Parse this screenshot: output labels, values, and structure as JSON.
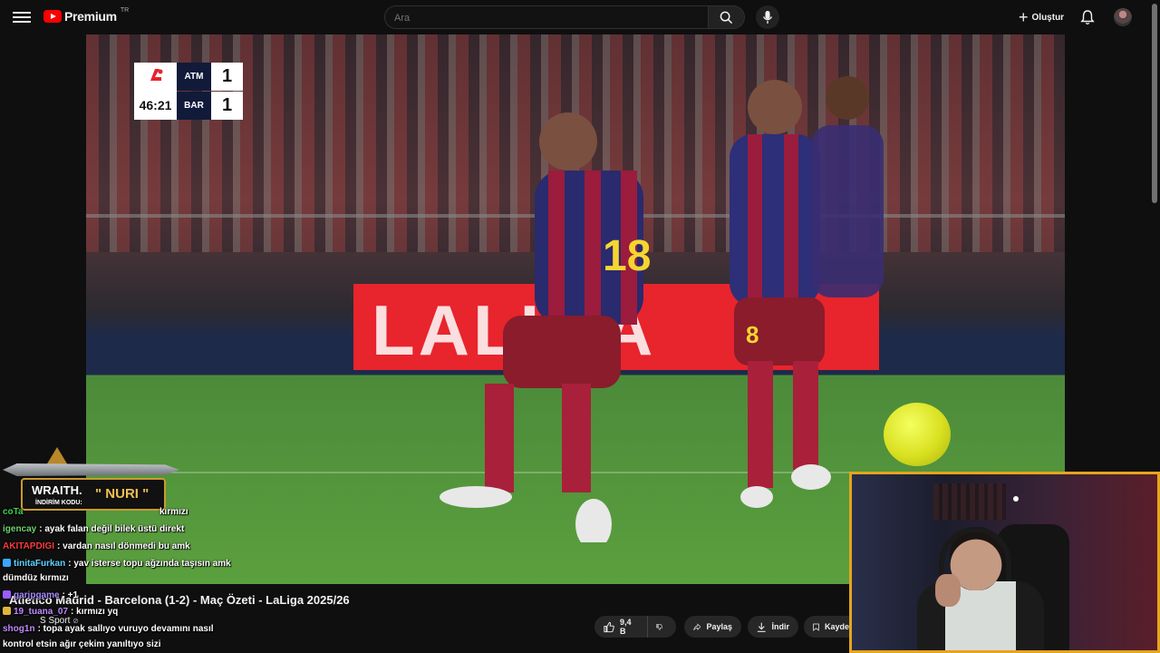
{
  "header": {
    "logo_text": "Premium",
    "logo_region": "TR",
    "search_placeholder": "Ara",
    "create_label": "Oluştur"
  },
  "scoreboard": {
    "clock": "46:21",
    "home_team": "ATM",
    "home_score": "1",
    "away_team": "BAR",
    "away_score": "1"
  },
  "video": {
    "board_text": "LALIGA",
    "title": "Atletico Madrid - Barcelona (1-2) - Maç Özeti - LaLiga 2025/26",
    "channel": "S Sport",
    "verified_mark": "⊘"
  },
  "actions": {
    "like_count": "9,4 B",
    "share_label": "Paylaş",
    "download_label": "İndir",
    "save_label": "Kayde"
  },
  "sponsor": {
    "brand": "WRAITH.",
    "code_label": "İNDİRİM KODU:",
    "code": "\" NURI \""
  },
  "chat": [
    {
      "user": "coTa",
      "text": "kırmızı",
      "color": "#3ccf4e"
    },
    {
      "user": "igencay",
      "text": ": ayak falan değil bilek üstü direkt",
      "color": "#6fd36f"
    },
    {
      "user": "AKITAPDIGI",
      "text": ": vardan nasıl dönmedi bu amk",
      "color": "#ff3b3b"
    },
    {
      "user": "tinitaFurkan",
      "text": ": yav isterse topu ağzında taşısın amk",
      "color": "#5fd3ff"
    },
    {
      "user": "",
      "text": "dümdüz kırmızı",
      "color": "#ffffff"
    },
    {
      "user": "garipgame",
      "text": ": +1",
      "color": "#a58bff"
    },
    {
      "user": "19_tuana_07",
      "text": ": kırmızı yq",
      "color": "#c08bff"
    },
    {
      "user": "shog1n",
      "text": ": topa ayak sallıyo vuruyo devamını nasıl",
      "color": "#c08bff"
    },
    {
      "user": "",
      "text": "kontrol etsin ağır çekim yanıltıyo sizi",
      "color": "#ffffff"
    }
  ]
}
